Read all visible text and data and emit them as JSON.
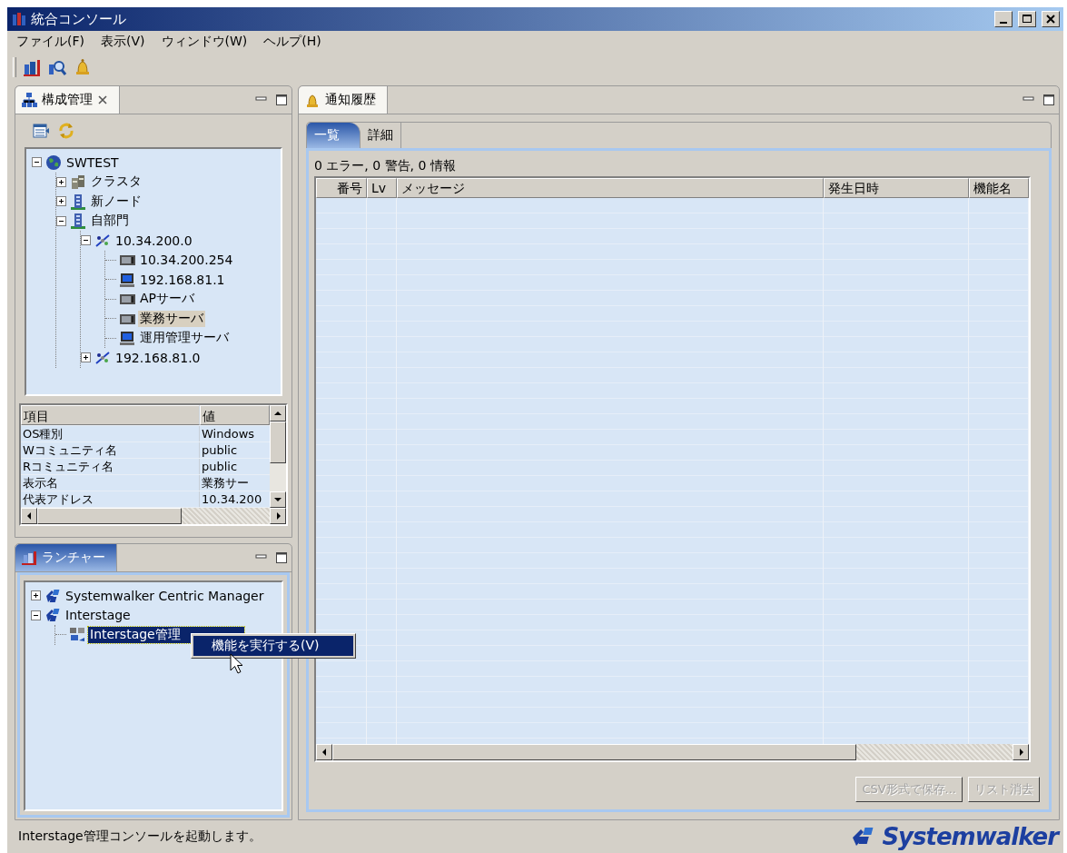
{
  "window": {
    "title": "統合コンソール"
  },
  "menu": [
    "ファイル(F)",
    "表示(V)",
    "ウィンドウ(W)",
    "ヘルプ(H)"
  ],
  "config_view": {
    "title": "構成管理",
    "focused": false,
    "tree": [
      {
        "label": "SWTEST",
        "kind": "globe",
        "expanded": true,
        "selected": false,
        "children": [
          {
            "label": "クラスタ",
            "kind": "cluster",
            "expanded": false,
            "selected": false
          },
          {
            "label": "新ノード",
            "kind": "building",
            "expanded": false,
            "selected": false
          },
          {
            "label": "自部門",
            "kind": "building",
            "expanded": true,
            "selected": false,
            "children": [
              {
                "label": "10.34.200.0",
                "kind": "network",
                "expanded": true,
                "selected": false,
                "children": [
                  {
                    "label": "10.34.200.254",
                    "kind": "server",
                    "selected": false
                  },
                  {
                    "label": "192.168.81.1",
                    "kind": "monitor",
                    "selected": false
                  },
                  {
                    "label": "APサーバ",
                    "kind": "server",
                    "selected": false
                  },
                  {
                    "label": "業務サーバ",
                    "kind": "server",
                    "selected": true
                  },
                  {
                    "label": "運用管理サーバ",
                    "kind": "monitor",
                    "selected": false
                  }
                ]
              },
              {
                "label": "192.168.81.0",
                "kind": "network",
                "expanded": false,
                "selected": false
              }
            ]
          }
        ]
      }
    ],
    "properties": {
      "columns": [
        "項目",
        "値"
      ],
      "rows": [
        [
          "OS種別",
          "Windows"
        ],
        [
          "Wコミュニティ名",
          "public"
        ],
        [
          "Rコミュニティ名",
          "public"
        ],
        [
          "表示名",
          "業務サー"
        ],
        [
          "代表アドレス",
          "10.34.200"
        ]
      ]
    }
  },
  "launcher_view": {
    "title": "ランチャー",
    "focused": true,
    "tree": [
      {
        "label": "Systemwalker Centric Manager",
        "kind": "product",
        "expanded": false,
        "selected": false
      },
      {
        "label": "Interstage",
        "kind": "product",
        "expanded": true,
        "selected": false,
        "children": [
          {
            "label": "Interstage管理",
            "kind": "console",
            "selected": true
          }
        ]
      }
    ],
    "context_menu": [
      {
        "label": "機能を実行する(V)",
        "selected": true
      }
    ]
  },
  "notification_view": {
    "title": "通知履歴",
    "focused": false,
    "tabs": [
      {
        "label": "一覧",
        "selected": true
      },
      {
        "label": "詳細",
        "selected": false
      }
    ],
    "summary": "0 エラー, 0 警告, 0 情報",
    "table": {
      "columns": [
        "番号",
        "Lv",
        "メッセージ",
        "発生日時",
        "機能名"
      ]
    },
    "buttons": [
      {
        "label": "CSV形式で保存...",
        "disabled": true
      },
      {
        "label": "リスト消去",
        "disabled": true
      }
    ]
  },
  "status_bar": {
    "message": "Interstage管理コンソールを起動します。",
    "logo": "Systemwalker"
  }
}
